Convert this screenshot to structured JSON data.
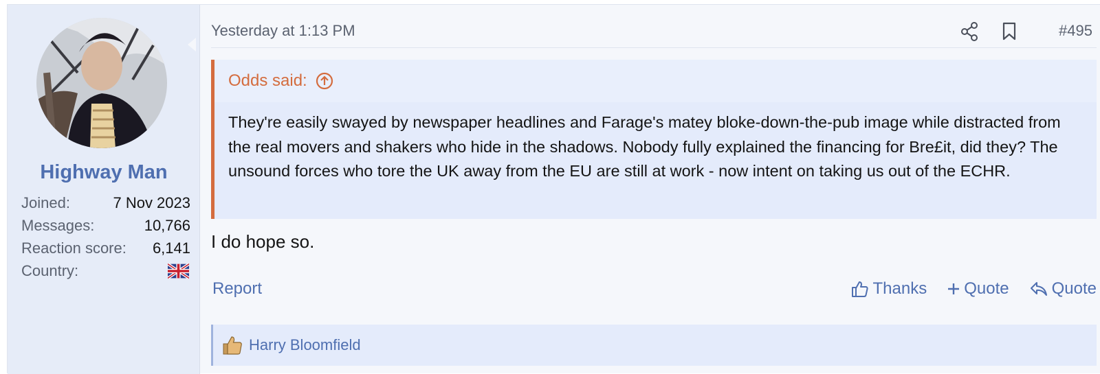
{
  "user": {
    "name": "Highway Man",
    "stats": [
      {
        "label": "Joined:",
        "value": "7 Nov 2023"
      },
      {
        "label": "Messages:",
        "value": "10,766"
      },
      {
        "label": "Reaction score:",
        "value": "6,141"
      },
      {
        "label": "Country:",
        "value": ""
      }
    ],
    "country_flag": "uk-flag-icon"
  },
  "post": {
    "time": "Yesterday at 1:13 PM",
    "number": "#495",
    "quote": {
      "author": "Odds said:",
      "text": "They're easily swayed by newspaper headlines and Farage's matey bloke-down-the-pub image while distracted from the real movers and shakers who hide in the shadows. Nobody fully explained the financing for Bre£it, did they? The unsound forces who tore the UK away from the EU are still at work - now intent on taking us out of the ECHR."
    },
    "body": "I do hope so."
  },
  "footer": {
    "report": "Report",
    "thanks": "Thanks",
    "multi_quote": "Quote",
    "quote": "Quote"
  },
  "reactions": {
    "users": "Harry Bloomfield"
  },
  "colors": {
    "accent": "#4f6fb0",
    "quote_border": "#d46c3e",
    "user_bg": "#e6ecf8"
  }
}
